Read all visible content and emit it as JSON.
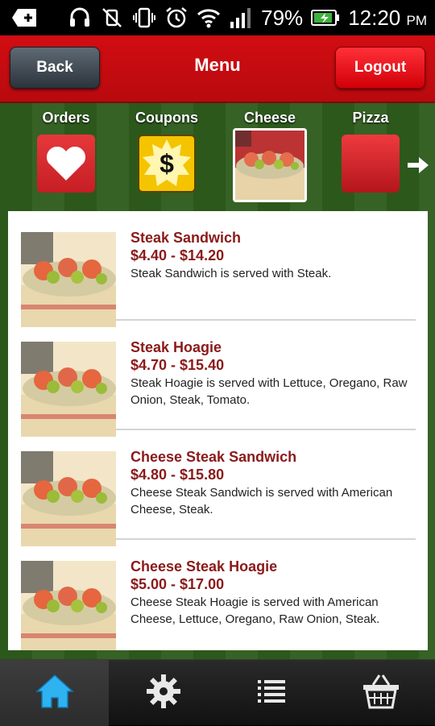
{
  "status_bar": {
    "battery_percent": "79%",
    "time": "12:20",
    "ampm": "PM",
    "icons": [
      "notification-plus-icon",
      "headset-icon",
      "vibrate-off-icon",
      "vibrate-icon",
      "alarm-icon",
      "wifi-icon",
      "signal-icon",
      "battery-charging-icon"
    ]
  },
  "header": {
    "back_label": "Back",
    "title": "Menu",
    "logout_label": "Logout"
  },
  "categories": [
    {
      "label": "Orders",
      "icon": "heart-icon"
    },
    {
      "label": "Coupons",
      "icon": "dollar-icon"
    },
    {
      "label": "Cheese",
      "icon": "sandwich-photo"
    },
    {
      "label": "Pizza",
      "icon": "red-tile"
    }
  ],
  "items": [
    {
      "name": "Steak Sandwich",
      "price": "$4.40 - $14.20",
      "description": "Steak Sandwich is served with Steak."
    },
    {
      "name": "Steak Hoagie",
      "price": "$4.70 - $15.40",
      "description": "Steak Hoagie is served with Lettuce, Oregano, Raw Onion, Steak, Tomato."
    },
    {
      "name": "Cheese Steak Sandwich",
      "price": "$4.80 - $15.80",
      "description": "Cheese Steak Sandwich is served with American Cheese, Steak."
    },
    {
      "name": "Cheese Steak Hoagie",
      "price": "$5.00 - $17.00",
      "description": "Cheese Steak Hoagie is served with American Cheese, Lettuce, Oregano, Raw Onion, Steak."
    }
  ],
  "bottom_nav": [
    "home-icon",
    "settings-gear-icon",
    "list-icon",
    "basket-icon"
  ],
  "colors": {
    "header_red": "#c80c10",
    "item_title": "#8b1a1a",
    "background_green": "#2f5d1e"
  }
}
